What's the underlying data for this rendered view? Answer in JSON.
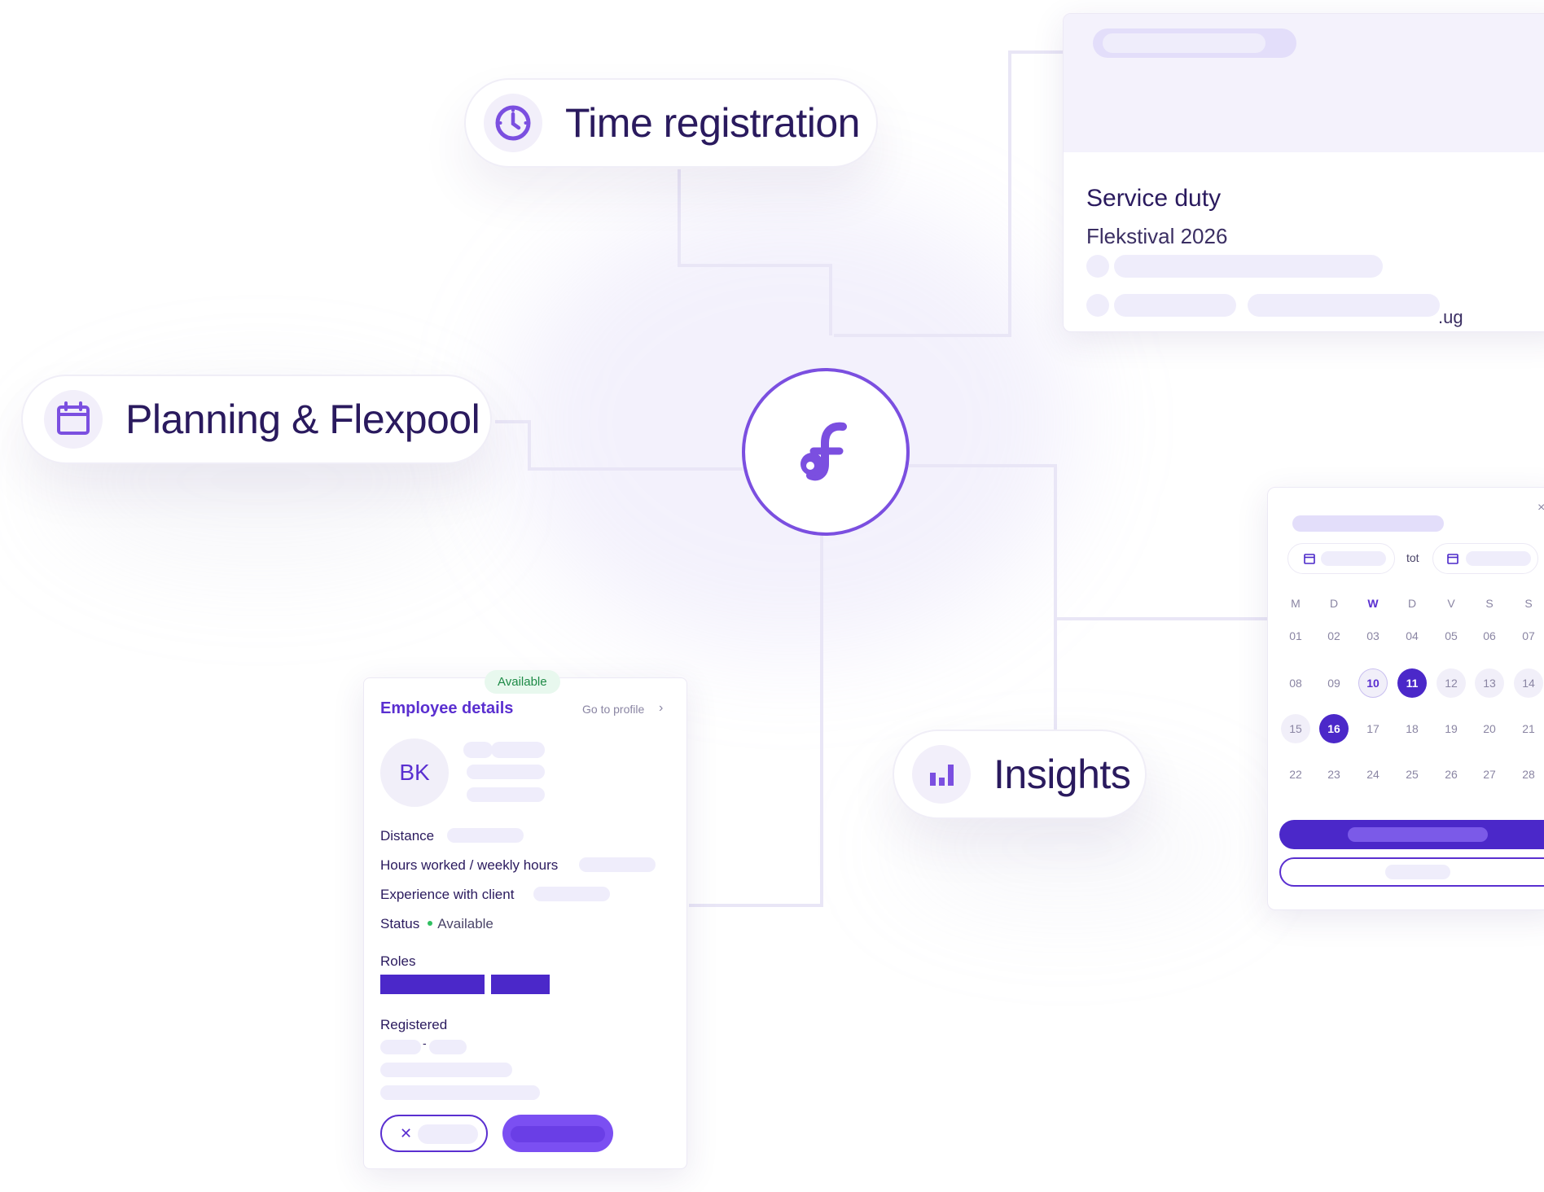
{
  "features": {
    "time_registration": "Time registration",
    "planning": "Planning & Flexpool",
    "insights": "Insights"
  },
  "icons": {
    "time": "clock-icon",
    "planning": "calendar-icon",
    "insights": "bar-chart-icon",
    "hub": "brand-logo-icon"
  },
  "colors": {
    "accent": "#7b4fe0",
    "primary": "#4b28c9",
    "text": "#2a1a5e",
    "skeleton": "#efedfb"
  },
  "service_card": {
    "title": "Service duty",
    "subtitle": "Flekstival 2026",
    "trailing_text": ".ug"
  },
  "employee_card": {
    "badge": "Available",
    "title": "Employee details",
    "profile_link": "Go to profile",
    "profile_chevron": "›",
    "initials": "BK",
    "distance_label": "Distance",
    "hours_label": "Hours worked / weekly hours",
    "experience_label": "Experience with client",
    "status_label": "Status",
    "status_value": "Available",
    "roles_label": "Roles",
    "registered_label": "Registered",
    "registered_separator": "-",
    "cancel_symbol": "✕"
  },
  "calendar": {
    "close_symbol": "×",
    "range_separator": "tot",
    "weekdays": [
      "M",
      "D",
      "W",
      "D",
      "V",
      "S",
      "S"
    ],
    "weeks": [
      [
        "01",
        "02",
        "03",
        "04",
        "05",
        "06",
        "07"
      ],
      [
        "08",
        "09",
        "10",
        "11",
        "12",
        "13",
        "14"
      ],
      [
        "15",
        "16",
        "17",
        "18",
        "19",
        "20",
        "21"
      ],
      [
        "22",
        "23",
        "24",
        "25",
        "26",
        "27",
        "28"
      ]
    ],
    "today": "10",
    "range_start": "11",
    "range_end": "16"
  }
}
